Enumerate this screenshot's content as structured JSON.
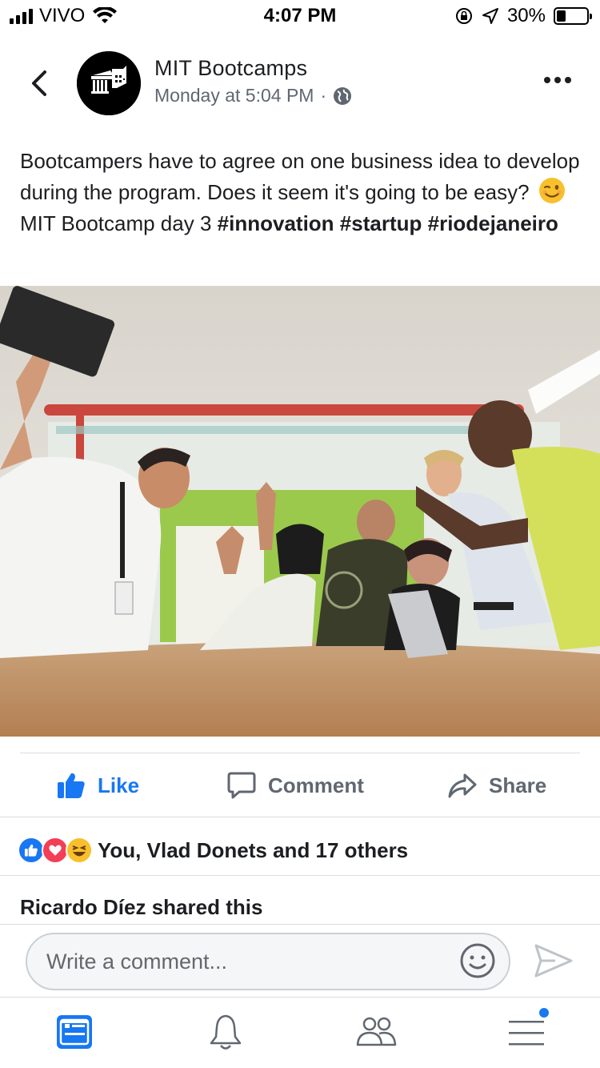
{
  "status_bar": {
    "carrier": "VIVO",
    "time": "4:07 PM",
    "battery_percent": "30%",
    "battery_level": 0.3
  },
  "post": {
    "page_name": "MIT Bootcamps",
    "timestamp": "Monday at 5:04 PM",
    "meta_separator": "·",
    "privacy_icon": "globe-icon",
    "text_part1": "Bootcampers have to agree on one business idea to develop during the program. Does it seem it's going to be easy?",
    "text_emoji": "winking-face-emoji",
    "text_part2": "MIT Bootcamp day 3",
    "hashtags": [
      "#innovation",
      "#startup",
      "#riodejaneiro"
    ]
  },
  "actions": {
    "like_label": "Like",
    "comment_label": "Comment",
    "share_label": "Share"
  },
  "reactions": {
    "icons": [
      "like-reaction",
      "love-reaction",
      "haha-reaction"
    ],
    "summary": "You, Vlad Donets and 17 others"
  },
  "shared_by": "Ricardo Díez shared this",
  "composer": {
    "placeholder": "Write a comment..."
  },
  "tabbar": {
    "items": [
      "news-feed",
      "notifications",
      "friends",
      "menu"
    ],
    "active": "news-feed"
  },
  "colors": {
    "brand_blue": "#1877f2",
    "text_primary": "#1c1e21",
    "text_secondary": "#606770",
    "divider": "#dadde1"
  }
}
